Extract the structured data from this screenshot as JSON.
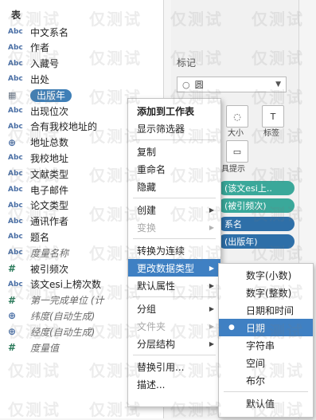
{
  "data_pane": {
    "section_title": "表",
    "fields": [
      {
        "icon": "Abc",
        "icon_name": "string-icon",
        "label": "中文系名"
      },
      {
        "icon": "Abc",
        "icon_name": "string-icon",
        "label": "作者"
      },
      {
        "icon": "Abc",
        "icon_name": "string-icon",
        "label": "入藏号"
      },
      {
        "icon": "Abc",
        "icon_name": "string-icon",
        "label": "出处"
      },
      {
        "icon": "▦",
        "icon_name": "calendar-icon",
        "label": "出版年"
      },
      {
        "icon": "Abc",
        "icon_name": "string-icon",
        "label": "出现位次"
      },
      {
        "icon": "Abc",
        "icon_name": "string-icon",
        "label": "合有我校地址的"
      },
      {
        "icon": "⊕",
        "icon_name": "globe-icon",
        "label": "地址总数"
      },
      {
        "icon": "Abc",
        "icon_name": "string-icon",
        "label": "我校地址"
      },
      {
        "icon": "Abc",
        "icon_name": "string-icon",
        "label": "文献类型"
      },
      {
        "icon": "Abc",
        "icon_name": "string-icon",
        "label": "电子邮件"
      },
      {
        "icon": "Abc",
        "icon_name": "string-icon",
        "label": "论文类型"
      },
      {
        "icon": "Abc",
        "icon_name": "string-icon",
        "label": "通讯作者"
      },
      {
        "icon": "Abc",
        "icon_name": "string-icon",
        "label": "题名"
      },
      {
        "icon": "Abc",
        "icon_name": "string-icon",
        "label": "度量名称"
      },
      {
        "icon": "#",
        "icon_name": "number-icon",
        "label": "被引频次"
      },
      {
        "icon": "Abc",
        "icon_name": "string-icon",
        "label": "该文esi上榜次数"
      },
      {
        "icon": "#",
        "icon_name": "number-icon",
        "label": "第一完成单位 (计"
      },
      {
        "icon": "⊕",
        "icon_name": "globe-icon",
        "label": "纬度(自动生成)"
      },
      {
        "icon": "⊕",
        "icon_name": "globe-icon",
        "label": "经度(自动生成)"
      },
      {
        "icon": "#",
        "icon_name": "number-icon",
        "label": "度量值"
      }
    ]
  },
  "marks": {
    "title": "标记",
    "mark_type": "圆",
    "buttons": [
      {
        "glyph": "T",
        "label": "标签"
      }
    ],
    "size_label": "大小",
    "tooltip_label": "具提示",
    "pills": [
      {
        "text": "(该文esi上..",
        "color": "green"
      },
      {
        "text": "(被引频次)",
        "color": "green"
      },
      {
        "text": "系名",
        "color": "blue"
      },
      {
        "text": "(出版年)",
        "color": "blue"
      }
    ]
  },
  "context_menu": {
    "items": [
      {
        "label": "添加到工作表",
        "bold": true
      },
      {
        "label": "显示筛选器"
      },
      {
        "sep": true
      },
      {
        "label": "复制"
      },
      {
        "label": "重命名"
      },
      {
        "label": "隐藏"
      },
      {
        "sep": true
      },
      {
        "label": "创建",
        "submenu": true
      },
      {
        "label": "变换",
        "submenu": true,
        "disabled": true
      },
      {
        "sep": true
      },
      {
        "label": "转换为连续"
      },
      {
        "label": "更改数据类型",
        "submenu": true,
        "highlighted": true
      },
      {
        "label": "默认属性",
        "submenu": true
      },
      {
        "sep": true
      },
      {
        "label": "分组",
        "submenu": true
      },
      {
        "label": "文件夹",
        "submenu": true,
        "disabled": true
      },
      {
        "label": "分层结构",
        "submenu": true
      },
      {
        "sep": true
      },
      {
        "label": "替换引用..."
      },
      {
        "label": "描述..."
      }
    ]
  },
  "data_type_submenu": {
    "items": [
      {
        "label": "数字(小数)"
      },
      {
        "label": "数字(整数)"
      },
      {
        "label": "日期和时间"
      },
      {
        "label": "日期",
        "checked": true,
        "highlighted": true
      },
      {
        "label": "字符串"
      },
      {
        "label": "空间"
      },
      {
        "label": "布尔"
      },
      {
        "sep": true
      },
      {
        "label": "默认值"
      }
    ]
  },
  "colors": {
    "highlight": "#3f80c3",
    "selected_field": "#3f7fb7",
    "green_pill": "#3aa89a",
    "blue_pill": "#2e6fa8"
  },
  "watermark": "仅测试"
}
